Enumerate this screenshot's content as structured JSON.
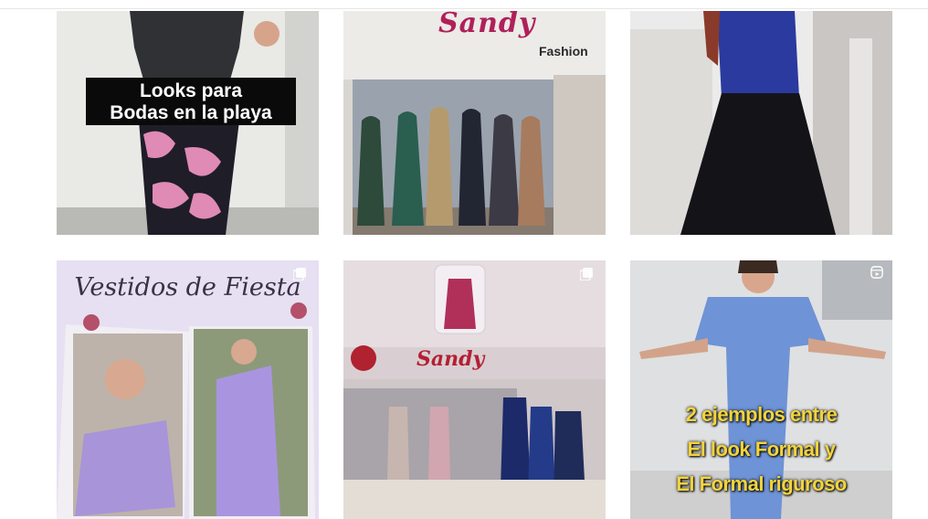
{
  "posts": [
    {
      "caption_lines": [
        "Looks para",
        "Bodas en la playa"
      ]
    },
    {
      "sign_brand": "Sandy",
      "sign_sub": "Fashion"
    },
    {},
    {
      "overlay_title": "Vestidos de Fiesta",
      "type_icon": "gallery-icon"
    },
    {
      "store_sign": "Sandy",
      "type_icon": "gallery-icon"
    },
    {
      "caption_lines": [
        "2 ejemplos entre",
        "El look Formal y",
        "El Formal riguroso"
      ],
      "type_icon": "reel-icon"
    }
  ],
  "colors": {
    "caption_bg": "#0a0a0a",
    "caption_text": "#ffffff",
    "sign_pink": "#b0205a",
    "reel_caption": "#f2d43a"
  }
}
